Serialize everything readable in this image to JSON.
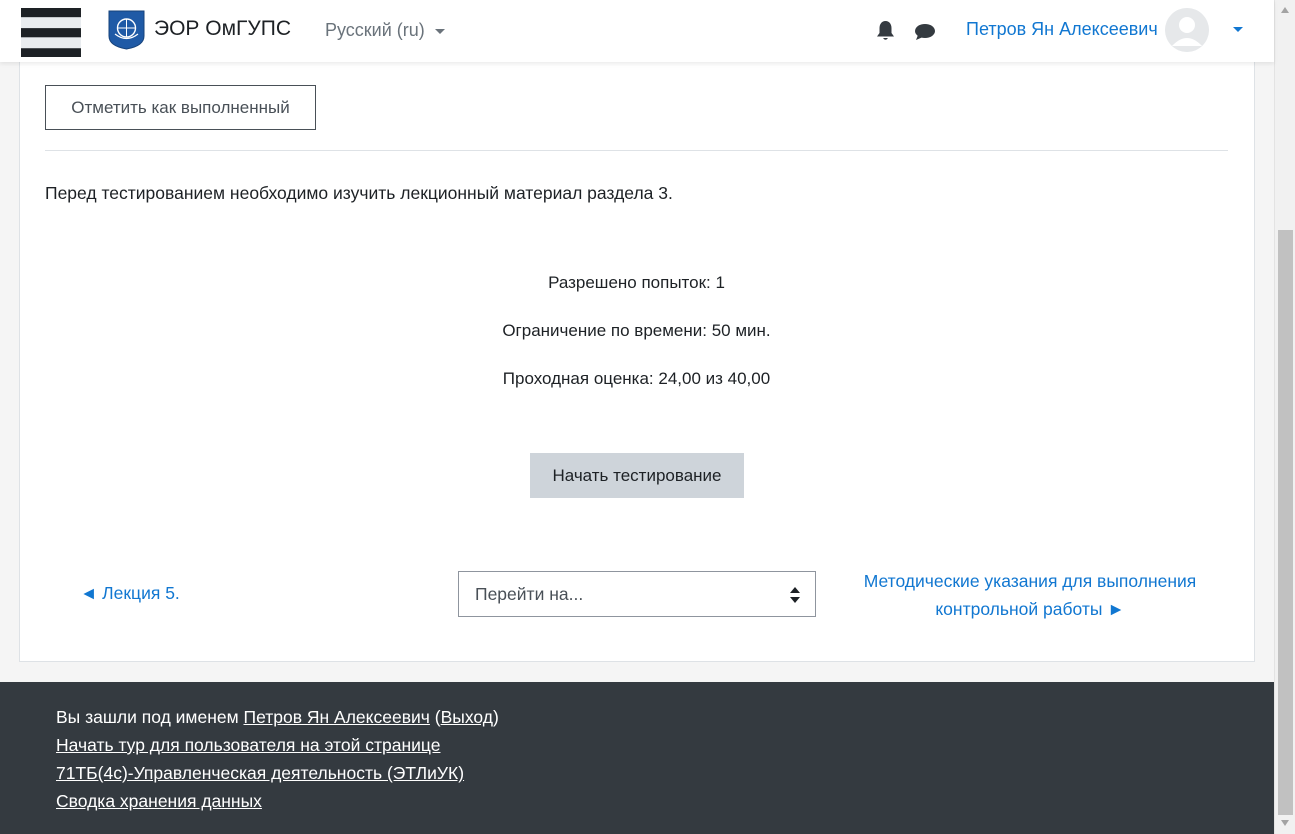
{
  "navbar": {
    "site_name": "ЭОР ОмГУПС",
    "language": "Русский ‎(ru)‎",
    "user_name": "Петров Ян Алексеевич",
    "icons": [
      "menu-icon",
      "logo-icon",
      "bell-icon",
      "chat-icon",
      "avatar-icon"
    ]
  },
  "activity": {
    "mark_done_label": "Отметить как выполненный",
    "intro_text": "Перед тестированием необходимо изучить лекционный материал раздела 3.",
    "attempts_allowed": "Разрешено попыток: 1",
    "time_limit": "Ограничение по времени: 50 мин.",
    "grade_to_pass": "Проходная оценка: 24,00 из 40,00",
    "start_button": "Начать тестирование"
  },
  "navigation": {
    "prev_label": "◄ Лекция 5.",
    "jump_placeholder": "Перейти на...",
    "next_label": "Методические указания для выполнения контрольной работы ►"
  },
  "footer": {
    "logged_in_prefix": "Вы зашли под именем",
    "logged_in_user": "Петров Ян Алексеевич",
    "logout_label": "Выход",
    "tour_label": "Начать тур для пользователя на этой странице",
    "course_label": "71ТБ(4с)-Управленческая деятельность (ЭТЛиУК)",
    "data_retention_label": "Сводка хранения данных"
  },
  "colors": {
    "link": "#1177d1",
    "footer_bg": "#343a40",
    "start_button_bg": "#ced4da"
  }
}
